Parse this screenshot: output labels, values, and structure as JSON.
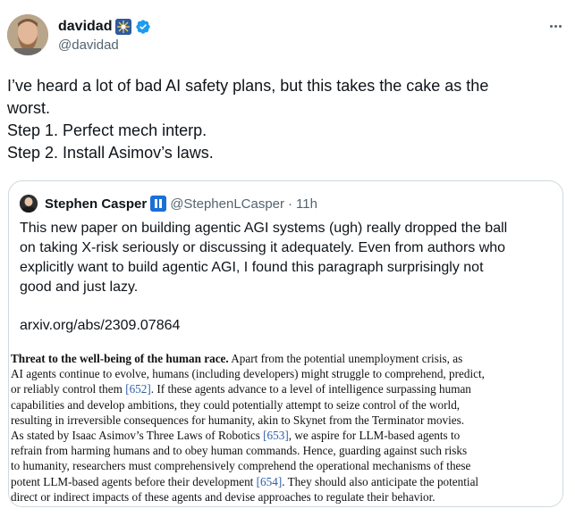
{
  "author": {
    "display_name": "davidad",
    "handle": "@davidad",
    "badge_emoji": "sparkle-badge-icon",
    "verified": true,
    "verified_color": "#1d9bf0"
  },
  "tweet": {
    "lines": [
      "I’ve heard a lot of bad AI safety plans, but this takes the cake as the",
      "worst.",
      "Step 1. Perfect mech interp.",
      "Step 2. Install Asimov’s laws."
    ]
  },
  "quote": {
    "display_name": "Stephen Casper",
    "handle": "@StephenLCasper",
    "separator": "·",
    "time": "11h",
    "lines": [
      "This new paper on building agentic AGI systems (ugh) really dropped the ball",
      "on taking X-risk seriously or discussing it adequately. Even from authors who",
      "explicitly want to build agentic AGI, I found this paragraph surprisingly not",
      "good and just lazy."
    ],
    "link": "arxiv.org/abs/2309.07864"
  },
  "paper": {
    "heading": "Threat to the well-being of the human race.",
    "lines": [
      {
        "pre": "   Apart from the potential unemployment crisis, as"
      },
      {
        "pre": "AI agents continue to evolve, humans (including developers) might struggle to comprehend, predict,"
      },
      {
        "pre": "or reliably control them ",
        "cite": "[652]",
        "post": ". If these agents advance to a level of intelligence surpassing human"
      },
      {
        "pre": "capabilities and develop ambitions, they could potentially attempt to seize control of the world,"
      },
      {
        "pre": "resulting in irreversible consequences for humanity, akin to Skynet from the Terminator movies."
      },
      {
        "pre": "As stated by Isaac Asimov’s Three Laws of Robotics ",
        "cite": "[653]",
        "post": ", we aspire for LLM-based agents to"
      },
      {
        "pre": "refrain from harming humans and to obey human commands. Hence, guarding against such risks"
      },
      {
        "pre": "to humanity, researchers must comprehensively comprehend the operational mechanisms of these"
      },
      {
        "pre": "potent LLM-based agents before their development ",
        "cite": "[654]",
        "post": ". They should also anticipate the potential"
      },
      {
        "pre": "direct or indirect impacts of these agents and devise approaches to regulate their behavior."
      }
    ]
  },
  "colors": {
    "text": "#0f1419",
    "secondary": "#536471",
    "border": "#cfd9de",
    "citation": "#2f5fa8"
  }
}
